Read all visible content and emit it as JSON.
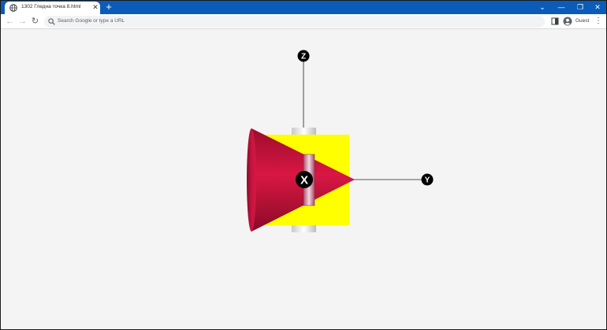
{
  "browser": {
    "tab_title": "1302 Гледна точка 8.html",
    "new_tab": "+",
    "tab_close": "✕",
    "address_placeholder": "Search Google or type a URL",
    "profile_label": "Guest",
    "menu_glyph": "⋮",
    "nav": {
      "back": "←",
      "forward": "→",
      "reload": "↻"
    },
    "window_controls": {
      "dropdown": "⌄",
      "minimize": "—",
      "restore": "❐",
      "close": "✕"
    }
  },
  "scene": {
    "axes": {
      "z": "Z",
      "y": "Y",
      "x": "X"
    },
    "colors": {
      "cone": "#cc1040",
      "box": "#ffff00",
      "axis_marker": "#000000"
    }
  }
}
